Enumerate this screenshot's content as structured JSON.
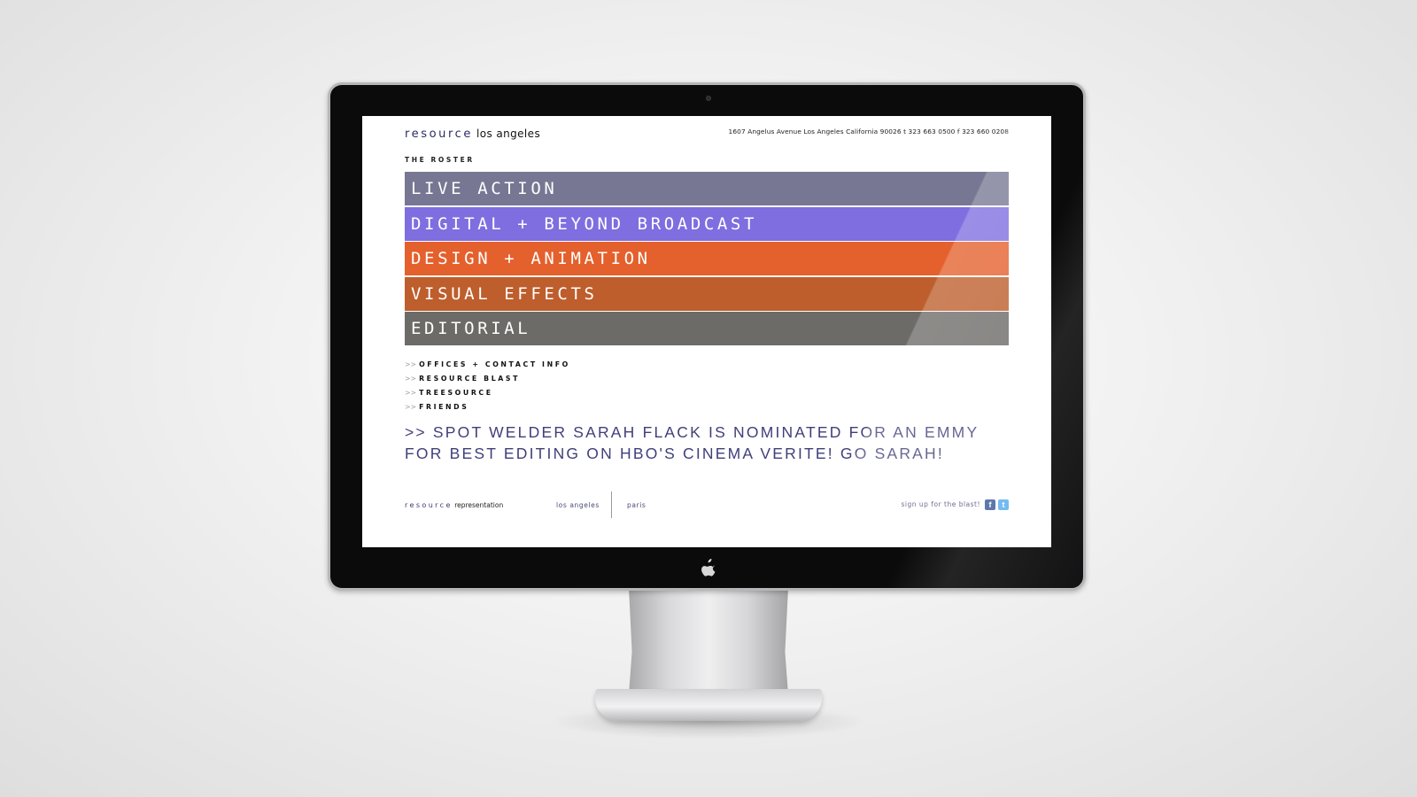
{
  "header": {
    "logo_word": "resource",
    "logo_city": "los angeles",
    "address": "1607 Angelus Avenue Los Angeles California 90026 t 323 663 0500 f 323 660 0208"
  },
  "roster": {
    "title": "THE ROSTER",
    "items": [
      {
        "label": "LIVE ACTION",
        "color": "#777793"
      },
      {
        "label": "DIGITAL + BEYOND BROADCAST",
        "color": "#7e6ee0"
      },
      {
        "label": "DESIGN + ANIMATION",
        "color": "#e4602c"
      },
      {
        "label": "VISUAL EFFECTS",
        "color": "#bd5e2c"
      },
      {
        "label": "EDITORIAL",
        "color": "#6d6b68"
      }
    ]
  },
  "links": {
    "arrows": ">>",
    "items": [
      {
        "label": "OFFICES + CONTACT INFO"
      },
      {
        "label": "RESOURCE BLAST"
      },
      {
        "label": "TREESOURCE"
      },
      {
        "label": "FRIENDS"
      }
    ]
  },
  "news": {
    "text": ">> SPOT WELDER SARAH FLACK IS NOMINATED FOR AN EMMY FOR BEST EDITING ON HBO'S CINEMA VERITE! GO SARAH!"
  },
  "footer": {
    "brand_word": "resource",
    "brand_suffix": "representation",
    "city_1": "los angeles",
    "city_2": "paris",
    "signup": "sign up for the blast!",
    "facebook_glyph": "f",
    "twitter_glyph": "t"
  },
  "icons": {
    "facebook": "facebook-icon",
    "twitter": "twitter-icon",
    "apple": "apple-logo-icon",
    "camera": "camera-icon"
  }
}
